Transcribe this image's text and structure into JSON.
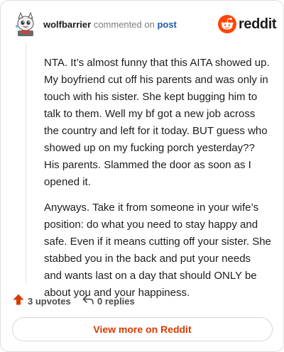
{
  "header": {
    "username": "wolfbarrier",
    "action_text": "commented on",
    "target_link": "post",
    "brand_name": "reddit",
    "avatar_icon": "snoo-avatar-icon",
    "brand_icon": "reddit-snoo-icon",
    "brand_color": "#ff4500"
  },
  "comment": {
    "paragraphs": [
      "NTA. It’s almost funny that this AITA showed up. My boyfriend cut off his parents and was only in touch with his sister. She kept bugging him to talk to them. Well my bf got a new job across the country and left for it today. BUT guess who showed up on my fucking porch yesterday?? His parents. Slammed the door as soon as I opened it.",
      "Anyways. Take it from someone in your wife’s position: do what you need to stay happy and safe. Even if it means cutting off your sister. She stabbed you in the back and put your needs and wants last on a day that should ONLY be about you and your happiness."
    ]
  },
  "actions": {
    "upvotes_label": "3 upvotes",
    "upvote_icon": "upvote-arrow-icon",
    "upvote_color": "#d93a00",
    "replies_label": "0 replies",
    "reply_icon": "reply-arrow-icon"
  },
  "footer": {
    "view_more_label": "View more on Reddit",
    "accent_color": "#d93a00"
  }
}
